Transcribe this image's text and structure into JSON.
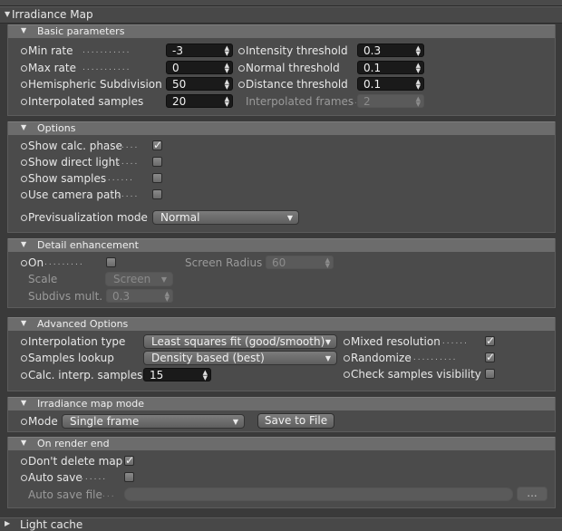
{
  "irradiance": {
    "title": "Irradiance Map",
    "basic": {
      "title": "Basic parameters",
      "min_rate": {
        "label": "Min rate",
        "value": "-3"
      },
      "max_rate": {
        "label": "Max rate",
        "value": "0"
      },
      "hsph": {
        "label": "Hemispheric Subdivision",
        "value": "50"
      },
      "interp": {
        "label": "Interpolated samples",
        "value": "20"
      },
      "int_thr": {
        "label": "Intensity threshold",
        "value": "0.3"
      },
      "nrm_thr": {
        "label": "Normal threshold",
        "value": "0.1"
      },
      "dst_thr": {
        "label": "Distance threshold",
        "value": "0.1"
      },
      "interp_frames": {
        "label": "Interpolated frames",
        "value": "2"
      }
    },
    "options": {
      "title": "Options",
      "show_calc": {
        "label": "Show calc. phase",
        "checked": true
      },
      "show_direct": {
        "label": "Show direct light",
        "checked": false
      },
      "show_samples": {
        "label": "Show samples",
        "checked": false
      },
      "camera_path": {
        "label": "Use camera path",
        "checked": false
      },
      "previs": {
        "label": "Previsualization mode",
        "value": "Normal"
      }
    },
    "detail": {
      "title": "Detail enhancement",
      "on": {
        "label": "On",
        "checked": false
      },
      "screen_radius": {
        "label": "Screen Radius",
        "value": "60"
      },
      "scale": {
        "label": "Scale",
        "value": "Screen"
      },
      "subdivs": {
        "label": "Subdivs mult.",
        "value": "0.3"
      }
    },
    "advanced": {
      "title": "Advanced Options",
      "interp_type": {
        "label": "Interpolation type",
        "value": "Least squares fit (good/smooth)"
      },
      "samples_lookup": {
        "label": "Samples lookup",
        "value": "Density based (best)"
      },
      "calc_interp": {
        "label": "Calc. interp. samples",
        "value": "15"
      },
      "mixed_res": {
        "label": "Mixed resolution",
        "checked": true
      },
      "randomize": {
        "label": "Randomize",
        "checked": true
      },
      "check_vis": {
        "label": "Check samples visibility",
        "checked": false
      }
    },
    "mode_section": {
      "title": "Irradiance map mode",
      "mode": {
        "label": "Mode",
        "value": "Single frame"
      },
      "save_btn": "Save to File"
    },
    "render_end": {
      "title": "On render end",
      "dont_delete": {
        "label": "Don't delete map",
        "checked": true
      },
      "auto_save": {
        "label": "Auto save",
        "checked": false
      },
      "auto_save_file": {
        "label": "Auto save file",
        "value": ""
      },
      "browse": "..."
    }
  },
  "light_cache": {
    "title": "Light cache"
  }
}
